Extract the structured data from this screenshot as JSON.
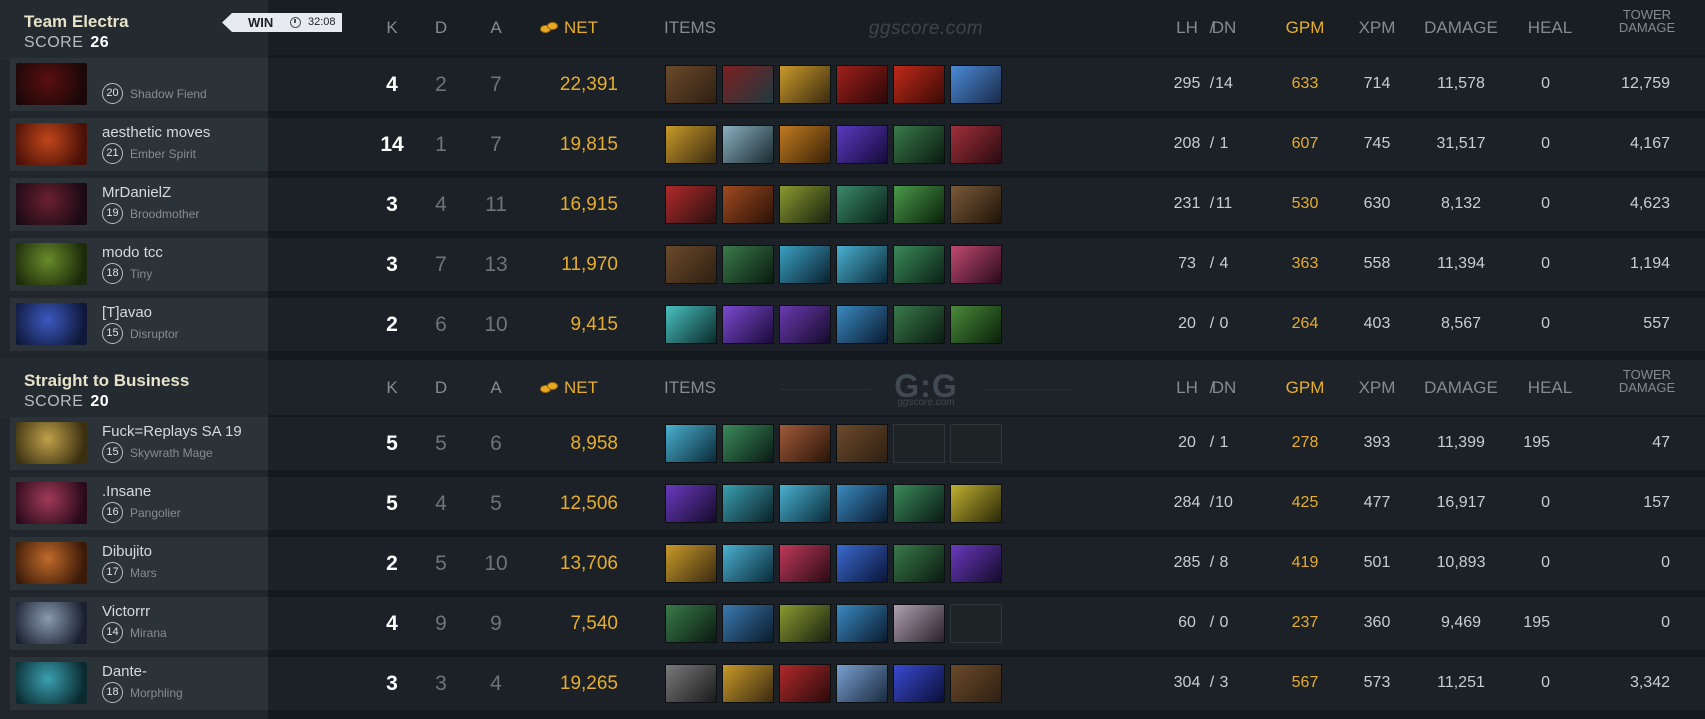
{
  "watermark_text": "ggscore.com",
  "logo_text": "G:G",
  "logo_sub": "ggscore.com",
  "result": {
    "label": "WIN",
    "time": "32:08"
  },
  "headers": {
    "k": "K",
    "d": "D",
    "a": "A",
    "net": "NET",
    "items": "ITEMS",
    "lh": "LH",
    "slash": "/",
    "dn": "DN",
    "gpm": "GPM",
    "xpm": "XPM",
    "damage": "DAMAGE",
    "heal": "HEAL",
    "tower_line1": "TOWER",
    "tower_line2": "DAMAGE"
  },
  "teams": [
    {
      "name": "Team Electra",
      "score_label": "SCORE",
      "score": "26",
      "players": [
        {
          "name": "",
          "level": "20",
          "hero": "Shadow Fiend",
          "k": "4",
          "d": "2",
          "a": "7",
          "net": "22,391",
          "lh": "295",
          "dn": "14",
          "gpm": "633",
          "xpm": "714",
          "damage": "11,578",
          "heal": "0",
          "tower": "12,759",
          "portrait": [
            "#5a0f10",
            "#1a0707"
          ],
          "items": [
            [
              "#6b4a2b",
              "#2f1f12"
            ],
            [
              "#7a2020",
              "#203a40"
            ],
            [
              "#c99a2a",
              "#3a2a10"
            ],
            [
              "#a0201a",
              "#2a0808"
            ],
            [
              "#c02a1a",
              "#3a0a05"
            ],
            [
              "#4a8ad8",
              "#1a2a48"
            ]
          ]
        },
        {
          "name": "aesthetic moves",
          "level": "21",
          "hero": "Ember Spirit",
          "k": "14",
          "d": "1",
          "a": "7",
          "net": "19,815",
          "lh": "208",
          "dn": "1",
          "gpm": "607",
          "xpm": "745",
          "damage": "31,517",
          "heal": "0",
          "tower": "4,167",
          "portrait": [
            "#c0461a",
            "#4a1008"
          ],
          "items": [
            [
              "#c99a2a",
              "#3a2a10"
            ],
            [
              "#8ab0c0",
              "#1a2a30"
            ],
            [
              "#c07a20",
              "#3a2208"
            ],
            [
              "#5a3ac0",
              "#140a38"
            ],
            [
              "#3a7a4a",
              "#0a1a10"
            ],
            [
              "#a0303a",
              "#2a0a10"
            ]
          ]
        },
        {
          "name": "MrDanielZ",
          "level": "19",
          "hero": "Broodmother",
          "k": "3",
          "d": "4",
          "a": "11",
          "net": "16,915",
          "lh": "231",
          "dn": "11",
          "gpm": "530",
          "xpm": "630",
          "damage": "8,132",
          "heal": "0",
          "tower": "4,623",
          "portrait": [
            "#6a2030",
            "#1a0a14"
          ],
          "items": [
            [
              "#b02a2a",
              "#2a1010"
            ],
            [
              "#a04a20",
              "#2a1208"
            ],
            [
              "#8a9a30",
              "#1a2010"
            ],
            [
              "#3a8a6a",
              "#0a2018"
            ],
            [
              "#4a9a4a",
              "#0a200a"
            ],
            [
              "#7a5a3a",
              "#201408"
            ]
          ]
        },
        {
          "name": "modo tcc",
          "level": "18",
          "hero": "Tiny",
          "k": "3",
          "d": "7",
          "a": "13",
          "net": "11,970",
          "lh": "73",
          "dn": "4",
          "gpm": "363",
          "xpm": "558",
          "damage": "11,394",
          "heal": "0",
          "tower": "1,194",
          "portrait": [
            "#6a8a2a",
            "#1a2a0a"
          ],
          "items": [
            [
              "#6b4a2b",
              "#2f1f12"
            ],
            [
              "#3a7a4a",
              "#0a1a10"
            ],
            [
              "#3aa0c0",
              "#0a2030"
            ],
            [
              "#4ab0d0",
              "#0a2a38"
            ],
            [
              "#3a8a5a",
              "#0a2014"
            ],
            [
              "#c04a70",
              "#2a0a1a"
            ]
          ]
        },
        {
          "name": "[T]avao",
          "level": "15",
          "hero": "Disruptor",
          "k": "2",
          "d": "6",
          "a": "10",
          "net": "9,415",
          "lh": "20",
          "dn": "0",
          "gpm": "264",
          "xpm": "403",
          "damage": "8,567",
          "heal": "0",
          "tower": "557",
          "portrait": [
            "#3a5ac0",
            "#10183a"
          ],
          "items": [
            [
              "#4ac0c0",
              "#0a2a2a"
            ],
            [
              "#7a4ad0",
              "#1a0a38"
            ],
            [
              "#6a3ab0",
              "#140a2a"
            ],
            [
              "#3a8ac0",
              "#0a1a30"
            ],
            [
              "#3a7a4a",
              "#0a1a10"
            ],
            [
              "#4a8a3a",
              "#0a200a"
            ]
          ]
        }
      ]
    },
    {
      "name": "Straight to Business",
      "score_label": "SCORE",
      "score": "20",
      "players": [
        {
          "name": "Fuck=Replays SA 19",
          "level": "15",
          "hero": "Skywrath Mage",
          "k": "5",
          "d": "5",
          "a": "6",
          "net": "8,958",
          "lh": "20",
          "dn": "1",
          "gpm": "278",
          "xpm": "393",
          "damage": "11,399",
          "heal": "195",
          "tower": "47",
          "portrait": [
            "#c0a04a",
            "#3a3010"
          ],
          "items": [
            [
              "#4ab0d0",
              "#0a2a38"
            ],
            [
              "#3a8a5a",
              "#0a1a14"
            ],
            [
              "#a05a3a",
              "#2a1408"
            ],
            [
              "#6b4a2b",
              "#2f1f12"
            ],
            null,
            null
          ]
        },
        {
          "name": ".Insane",
          "level": "16",
          "hero": "Pangolier",
          "k": "5",
          "d": "4",
          "a": "5",
          "net": "12,506",
          "lh": "284",
          "dn": "10",
          "gpm": "425",
          "xpm": "477",
          "damage": "16,917",
          "heal": "0",
          "tower": "157",
          "portrait": [
            "#a03a5a",
            "#2a0a18"
          ],
          "items": [
            [
              "#6a3ac0",
              "#140a2a"
            ],
            [
              "#3aa0b0",
              "#0a2028"
            ],
            [
              "#4ab0d0",
              "#0a2a38"
            ],
            [
              "#3a8ac0",
              "#0a1a30"
            ],
            [
              "#3a8a5a",
              "#0a1a14"
            ],
            [
              "#c0b030",
              "#2a2808"
            ]
          ]
        },
        {
          "name": "Dibujito",
          "level": "17",
          "hero": "Mars",
          "k": "2",
          "d": "5",
          "a": "10",
          "net": "13,706",
          "lh": "285",
          "dn": "8",
          "gpm": "419",
          "xpm": "501",
          "damage": "10,893",
          "heal": "0",
          "tower": "0",
          "portrait": [
            "#c06a2a",
            "#3a1a08"
          ],
          "items": [
            [
              "#c99a2a",
              "#3a2a10"
            ],
            [
              "#4ab0d0",
              "#0a2a38"
            ],
            [
              "#c03a5a",
              "#2a0a14"
            ],
            [
              "#3a6ad0",
              "#0a1438"
            ],
            [
              "#3a7a4a",
              "#0a1a10"
            ],
            [
              "#6a3ac0",
              "#140a2a"
            ]
          ]
        },
        {
          "name": "Victorrr",
          "level": "14",
          "hero": "Mirana",
          "k": "4",
          "d": "9",
          "a": "9",
          "net": "7,540",
          "lh": "60",
          "dn": "0",
          "gpm": "237",
          "xpm": "360",
          "damage": "9,469",
          "heal": "195",
          "tower": "0",
          "portrait": [
            "#8a9ab0",
            "#1a2030"
          ],
          "items": [
            [
              "#3a7a4a",
              "#0a1a10"
            ],
            [
              "#3a7ab0",
              "#0a1a2a"
            ],
            [
              "#8a9a30",
              "#1a2010"
            ],
            [
              "#3a8ac0",
              "#0a1a30"
            ],
            [
              "#b0a0b0",
              "#2a202a"
            ],
            null
          ]
        },
        {
          "name": "Dante-",
          "level": "18",
          "hero": "Morphling",
          "k": "3",
          "d": "3",
          "a": "4",
          "net": "19,265",
          "lh": "304",
          "dn": "3",
          "gpm": "567",
          "xpm": "573",
          "damage": "11,251",
          "heal": "0",
          "tower": "3,342",
          "portrait": [
            "#3aa0b0",
            "#0a2a30"
          ],
          "items": [
            [
              "#7a7a7a",
              "#1a1a1a"
            ],
            [
              "#c99a2a",
              "#3a2a10"
            ],
            [
              "#b02a2a",
              "#2a0a0a"
            ],
            [
              "#7aa0d0",
              "#1a2a40"
            ],
            [
              "#3a4ad0",
              "#0a0e38"
            ],
            [
              "#6b4a2b",
              "#2f1f12"
            ]
          ]
        }
      ]
    }
  ]
}
